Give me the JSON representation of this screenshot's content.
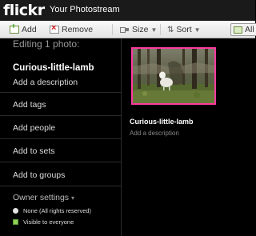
{
  "app": {
    "logo": "flickr",
    "title": "Your Photostream"
  },
  "toolbar": {
    "add": {
      "label": "Add",
      "icon": "add-icon"
    },
    "remove": {
      "label": "Remove",
      "icon": "remove-icon"
    },
    "size": {
      "label": "Size",
      "icon": "size-icon"
    },
    "sort": {
      "label": "Sort",
      "icon": "sort-icon"
    },
    "all": {
      "label": "All",
      "icon": "select-all-icon"
    }
  },
  "editor": {
    "heading": "Editing 1 photo:",
    "photo_title": "Curious-little-lamb",
    "add_description": "Add a description",
    "add_tags": "Add tags",
    "add_people": "Add people",
    "add_to_sets": "Add to sets",
    "add_to_groups": "Add to groups",
    "owner_settings": "Owner settings",
    "license": "None (All rights reserved)",
    "privacy": "Visible to everyone"
  },
  "photo": {
    "title": "Curious-little-lamb",
    "description": "Add a description",
    "selected_color": "#ff3aa0"
  }
}
